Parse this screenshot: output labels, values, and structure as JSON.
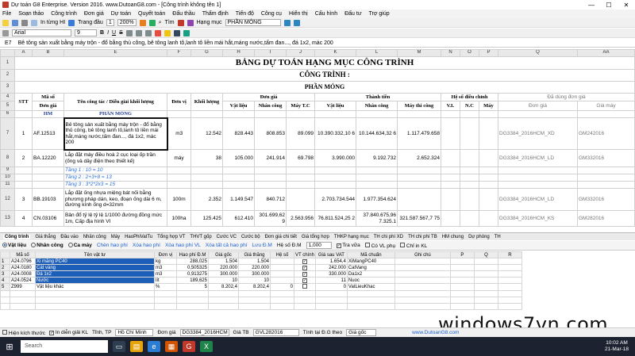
{
  "window": {
    "title": "Dự toán G8 Enterprise. Version 2016. www.DutoanG8.com - [Công trình không tên 1]"
  },
  "menu": [
    "File",
    "Soạn thảo",
    "Công trình",
    "Đơn giá",
    "Dự toán",
    "Quyết toán",
    "Đấu thầu",
    "Thẩm định",
    "Tiến độ",
    "Công cụ",
    "Hiển thị",
    "Cấu hình",
    "Đấu tư",
    "Trợ giúp"
  ],
  "toolbar1": {
    "print_mode": "In từng HI",
    "page": "Trang đầu",
    "zoom_level": "1",
    "zoom": "200%",
    "search_label": "Tìm",
    "category_label": "Hạng mục",
    "category_value": "PHẦN MÓNG"
  },
  "toolbar2": {
    "font": "Arial",
    "size": "9",
    "bold": "B",
    "italic": "I",
    "underline": "U",
    "strike": "S"
  },
  "formula": {
    "cell": "E7",
    "content": "Bê tông sản xuất bằng máy trộn - đổ bằng thủ công, bê tông lanh tô,lanh tô liền mái hắt,máng nước,tấm đan..., đá 1x2, mác 200"
  },
  "columns": [
    "A",
    "B",
    "E",
    "F",
    "G",
    "H",
    "I",
    "J",
    "K",
    "L",
    "M",
    "N",
    "O",
    "P",
    "Q",
    "AA",
    "AB"
  ],
  "sheet": {
    "title": "BẢNG DỰ TOÁN HẠNG MỤC CÔNG TRÌNH",
    "project": "CÔNG TRÌNH :",
    "section": "PHẦN MÓNG",
    "headers": {
      "stt": "STT",
      "code": "Mã số",
      "code_sub": "Đơn giá",
      "work": "Tên công tác / Diễn giải khối lượng",
      "unit": "Đơn vị",
      "qty": "Khối lượng",
      "dongia": "Đơn giá",
      "thanhtien": "Thành tiền",
      "heso": "Hệ số điều chỉnh",
      "dadung": "Đã dùng đơn giá",
      "vl": "Vật liệu",
      "nc": "Nhân công",
      "mtc": "Máy T.C",
      "vl2": "Vật liệu",
      "nc2": "Nhân công",
      "mtc2": "Máy thi công",
      "vl3": "V.L",
      "nc3": "N.C",
      "may3": "Máy",
      "dongia_col": "Đơn giá",
      "giamay": "Giá máy",
      "hm": "HM",
      "phanmong": "PHẦN MÓNG"
    },
    "rows": [
      {
        "rn": "7",
        "stt": "1",
        "code": "AF.12513",
        "work": "Bê tông sản xuất bằng máy trộn - đổ bằng thủ công, bê tông lanh tô,lanh tô liền mái hắt,máng nước,tấm đan..., đá 1x2, mác 200",
        "unit": "m3",
        "qty": "12.542",
        "vl": "828.443",
        "nc": "808.853",
        "mtc": "89.099",
        "vl2": "10.390.332,10 6",
        "nc2": "10.144.634,32 6",
        "mtc2": "1.117.479.658",
        "dg": "DG3384_2016HCM_XD",
        "gm": "GM242016"
      },
      {
        "rn": "8",
        "stt": "2",
        "code": "BA.12220",
        "work": "Lắp đặt máy điều hoà 2 cục loại ốp trần (ống và dây điện theo thiết kế)",
        "unit": "máy",
        "qty": "38",
        "vl": "105.000",
        "nc": "241.914",
        "mtc": "69.798",
        "vl2": "3.990.000",
        "nc2": "9.192.732",
        "mtc2": "2.652.324",
        "dg": "DG3384_2016HCM_LD",
        "gm": "GM332016"
      },
      {
        "rn": "9",
        "work": "Tầng 1 : 10 = 10"
      },
      {
        "rn": "10",
        "work": "Tầng 2 : 2+3+8 = 13"
      },
      {
        "rn": "11",
        "work": "Tầng 3 : 3*2*2x3 = 15"
      },
      {
        "rn": "12",
        "stt": "3",
        "code": "BB.19103",
        "work": "Lắp đặt ống nhựa miệng bát nối bằng phương pháp dán, keo, đoạn ống dài 6 m, đường kính ống d=32mm",
        "unit": "100m",
        "qty": "2.352",
        "vl": "1.149.547",
        "nc": "840.712",
        "vl2": "2.703.734.544",
        "nc2": "1.977.354.624",
        "dg": "DG3384_2016HCM_LD",
        "gm": "GM332016"
      },
      {
        "rn": "13",
        "stt": "4",
        "code": "CN.03106",
        "work": "Bản đổ tỷ lệ tỷ lệ 1/1000 đường đồng mức 1m, Cấp địa hình VI",
        "unit": "100ha",
        "qty": "125.425",
        "vl": "612.410",
        "nc": "301.699,62 9",
        "mtc": "2.563.956",
        "vl2": "76.811.524,25 2",
        "nc2": "37.840.675,96 7.325.1",
        "mtc2": "321.587.567,7 75",
        "dg": "DG3384_2016HCM_KS",
        "gm": "GM282016"
      }
    ]
  },
  "sheet_tabs": [
    "Công trình",
    "Giá thắng",
    "Đầu vào",
    "Nhân công",
    "Máy",
    "HaoPhiVatTu",
    "Tổng hợp VT",
    "THVT gốp",
    "Cước VC",
    "Cước bộ",
    "Đơn giá chi tiết",
    "Giá tổng hợp",
    "THKP hạng mục",
    "TH chi phí XD",
    "TH chi phí TB",
    "HM chung",
    "Dự phòng",
    "TH"
  ],
  "subbar": {
    "vatlieu": "Vật liệu",
    "nhancong": "Nhân công",
    "camay": "Ca máy",
    "links": [
      "Chèn hao phí",
      "Xóa hao phí",
      "Xóa hao phí VL",
      "Xóa tất cả hao phí",
      "Lưu Đ.M"
    ],
    "hesodm": "Hệ số Đ.M",
    "hesodm_value": "1,000",
    "travua": "Tra vữa",
    "covlphu": "Có VL phụ",
    "chiinkl": "Chỉ in KL"
  },
  "lower": {
    "headers": [
      "Mã số",
      "Tên vật tư",
      "Đơn vị",
      "Hao phí Đ.M",
      "Giá gốc",
      "Giá thắng",
      "Hệ số",
      "VT chính",
      "Giá sau VAT",
      "Mã chuẩn",
      "Ghi chú",
      "P",
      "Q",
      "R"
    ],
    "rows": [
      {
        "n": "1",
        "code": "A24.0796",
        "name": "Xi măng PC40",
        "unit": "kg",
        "hp": "288,025",
        "goc": "1.504",
        "thang": "1.504",
        "hs": "",
        "chk": "✓",
        "vat": "1.654,4",
        "ma": "XiMangPC40"
      },
      {
        "n": "2",
        "code": "A24.0180",
        "name": "Cát vàng",
        "unit": "m3",
        "hp": "0,505325",
        "goc": "220.000",
        "thang": "220.000",
        "hs": "",
        "chk": "✓",
        "vat": "242.000",
        "ma": "CatVang"
      },
      {
        "n": "3",
        "code": "A24.0008",
        "name": "Đá 1x2",
        "unit": "m3",
        "hp": "0,913275",
        "goc": "300.000",
        "thang": "300.000",
        "hs": "",
        "chk": "✓",
        "vat": "330.000",
        "ma": "Da1x2"
      },
      {
        "n": "4",
        "code": "A24.0524",
        "name": "Nước",
        "unit": "lít",
        "hp": "189,625",
        "goc": "10",
        "thang": "10",
        "hs": "",
        "chk": "✓",
        "vat": "11",
        "ma": "Nuoc"
      },
      {
        "n": "5",
        "code": "Z999",
        "name": "Vật liệu khác",
        "unit": "%",
        "hp": "5",
        "goc": "8.202,4",
        "thang": "8.202,4",
        "hs": "0",
        "chk": "",
        "vat": "0",
        "ma": "VatLieuKhac"
      }
    ]
  },
  "bottombar": {
    "hienkichthuoc": "Hiện kích thước",
    "indiengiai": "In diễn giải KL",
    "tinh_label": "Tỉnh, TP",
    "tinh": "Hồ Chí Minh",
    "dongia_label": "Đơn giá",
    "dongia": "DG3384_2016HCM",
    "giatb_label": "Giá TB",
    "giatb": "GVL282016",
    "tinhtai_label": "Tính tại Đ.G theo",
    "tinhtai": "Giá gốc",
    "website": "www.DutoanG8.com"
  },
  "watermark": "windows7vn.com",
  "taskbar": {
    "search": "Search",
    "time": "10:02 AM",
    "date": "21-Mar-18"
  }
}
